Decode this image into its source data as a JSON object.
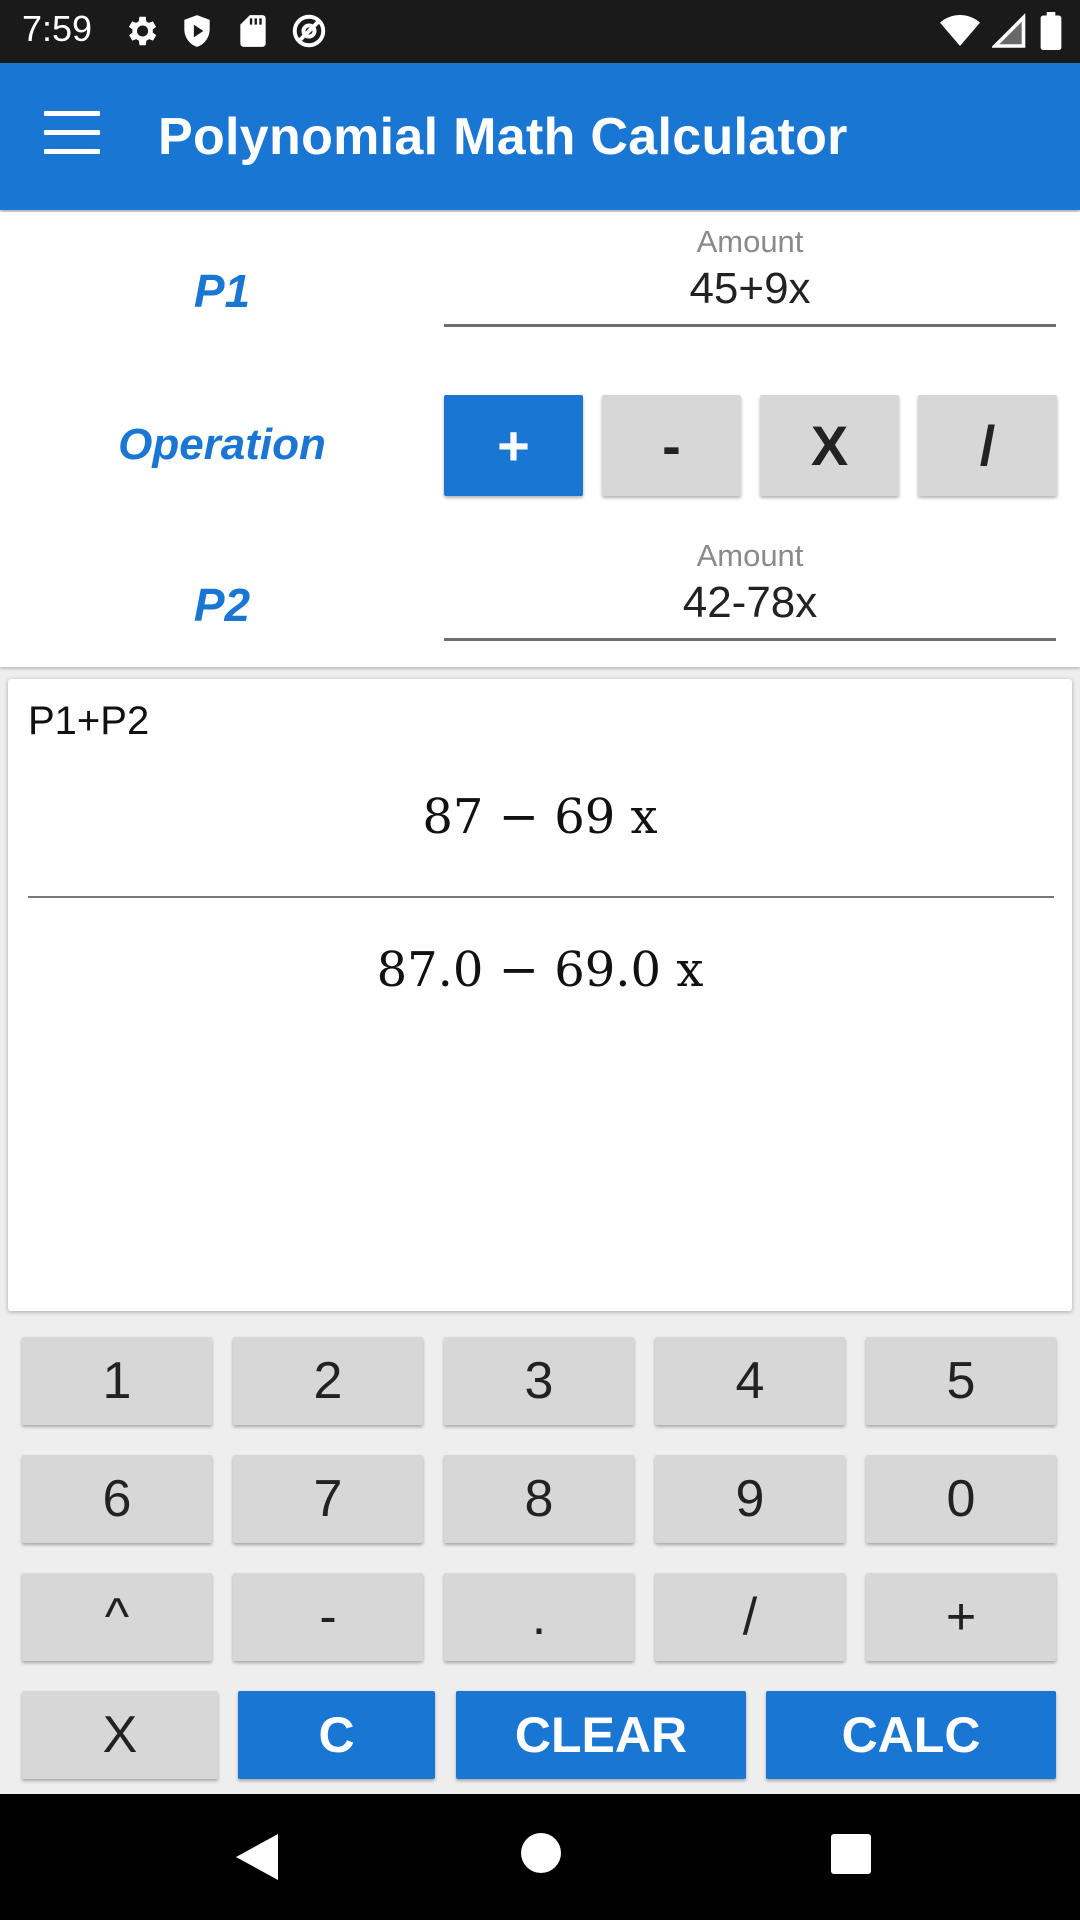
{
  "status_bar": {
    "time": "7:59",
    "left_icons": [
      "settings-icon",
      "shield-play-icon",
      "sd-card-icon",
      "at-sign-icon"
    ],
    "right_icons": [
      "wifi-icon",
      "signal-icon",
      "battery-icon"
    ]
  },
  "app_bar": {
    "title": "Polynomial Math Calculator",
    "menu_icon": "hamburger-menu-icon"
  },
  "inputs": {
    "p1": {
      "label": "P1",
      "hint": "Amount",
      "value": "45+9x"
    },
    "operation": {
      "label": "Operation",
      "options": [
        "+",
        "-",
        "X",
        "/"
      ],
      "selected": "+"
    },
    "p2": {
      "label": "P2",
      "hint": "Amount",
      "value": "42-78x"
    }
  },
  "result": {
    "expression_label": "P1+P2",
    "exact": "87 − 69 x",
    "decimal": "87.0 − 69.0 x"
  },
  "keypad": {
    "row1": [
      "1",
      "2",
      "3",
      "4",
      "5"
    ],
    "row2": [
      "6",
      "7",
      "8",
      "9",
      "0"
    ],
    "row3": [
      "^",
      "-",
      ".",
      "/",
      "+"
    ],
    "row4": [
      "X",
      "C",
      "CLEAR",
      "CALC"
    ]
  },
  "colors": {
    "primary": "#1976d2",
    "button_gray": "#d7d7d7",
    "status_bar": "#1a1a1a"
  }
}
